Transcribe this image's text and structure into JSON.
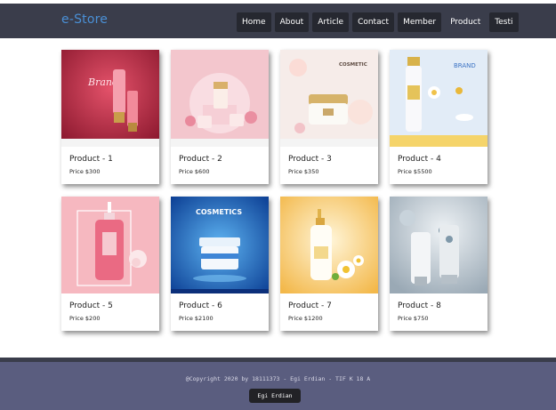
{
  "header": {
    "brand": "e-Store",
    "nav": [
      {
        "label": "Home"
      },
      {
        "label": "About"
      },
      {
        "label": "Article"
      },
      {
        "label": "Contact"
      },
      {
        "label": "Member"
      },
      {
        "label": "Product"
      },
      {
        "label": "Testi"
      }
    ]
  },
  "products": [
    {
      "title": "Product - 1",
      "price": "Price $300",
      "image_text": "Brand",
      "colors": {
        "bg": "#c8304a",
        "accent": "#f07a8a"
      }
    },
    {
      "title": "Product - 2",
      "price": "Price $600",
      "colors": {
        "bg": "#f2c4cc",
        "accent": "#e98ea0"
      }
    },
    {
      "title": "Product - 3",
      "price": "Price $350",
      "image_text": "COSMETIC",
      "colors": {
        "bg": "#f5ebe8",
        "accent": "#d6b46e"
      }
    },
    {
      "title": "Product - 4",
      "price": "Price $5500",
      "image_text": "BRAND",
      "colors": {
        "bg": "#dde9f6",
        "accent": "#e3b93e"
      }
    },
    {
      "title": "Product - 5",
      "price": "Price $200",
      "colors": {
        "bg": "#f7b7bf",
        "accent": "#e5506c"
      }
    },
    {
      "title": "Product - 6",
      "price": "Price $2100",
      "image_text": "COSMETICS",
      "colors": {
        "bg": "#1f63b8",
        "accent": "#5fb1f0"
      }
    },
    {
      "title": "Product - 7",
      "price": "Price $1200",
      "colors": {
        "bg": "#f6cc6c",
        "accent": "#fff4d6"
      }
    },
    {
      "title": "Product - 8",
      "price": "Price $750",
      "colors": {
        "bg": "#c8d2da",
        "accent": "#8fa5b3"
      }
    }
  ],
  "footer": {
    "copyright": "@Copyright 2020 by 18111373 - Egi Erdian - TIF K 18 A",
    "button": "Egi Erdian"
  },
  "colors": {
    "navbar": "#3a3d4b",
    "brand": "#4a90d6",
    "nav_item": "#262830",
    "footer": "#5a5d7f"
  }
}
